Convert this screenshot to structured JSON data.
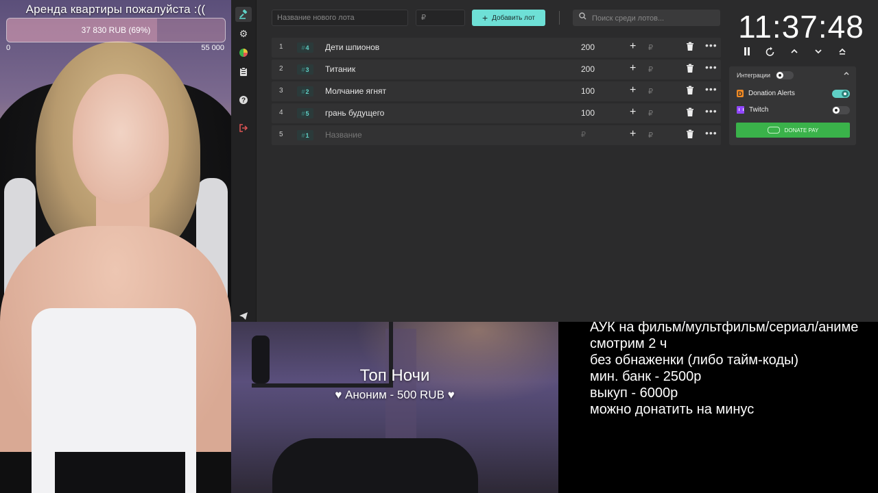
{
  "donation_goal": {
    "title": "Аренда квартиры пожалуйста :((",
    "progress_label": "37 830 RUB (69%)",
    "progress_fraction": 0.69,
    "min_label": "0",
    "max_label": "55 000"
  },
  "sidebar": {
    "items": [
      {
        "icon": "gavel-icon",
        "glyph": "⚒"
      },
      {
        "icon": "gear-icon",
        "glyph": "⚙"
      },
      {
        "icon": "pie-chart-icon",
        "glyph": "◕"
      },
      {
        "icon": "clipboard-icon",
        "glyph": "📋"
      },
      {
        "icon": "help-icon",
        "glyph": "?"
      },
      {
        "icon": "logout-icon",
        "glyph": "⇥"
      }
    ],
    "bottom_icon": "telegram-icon"
  },
  "toolbar": {
    "lot_name_placeholder": "Название нового лота",
    "lot_price_placeholder": "₽",
    "add_lot_label": "Добавить лот",
    "search_placeholder": "Поиск среди лотов..."
  },
  "lots": [
    {
      "index": "1",
      "tag": "4",
      "title": "Дети шпионов",
      "amount": "200",
      "placeholder": false
    },
    {
      "index": "2",
      "tag": "3",
      "title": "Титаник",
      "amount": "200",
      "placeholder": false
    },
    {
      "index": "3",
      "tag": "2",
      "title": "Молчание ягнят",
      "amount": "100",
      "placeholder": false
    },
    {
      "index": "4",
      "tag": "5",
      "title": "грань будущего",
      "amount": "100",
      "placeholder": false
    },
    {
      "index": "5",
      "tag": "1",
      "title": "Название",
      "amount": "₽",
      "placeholder": true
    }
  ],
  "row_ruble": "₽",
  "timer": {
    "display": "11:37:48"
  },
  "integrations": {
    "title": "Интеграции",
    "master_enabled": false,
    "donation_alerts_label": "Donation Alerts",
    "donation_alerts_enabled": true,
    "twitch_label": "Twitch",
    "twitch_enabled": false,
    "donatepay_label": "DONATE PAY"
  },
  "overlay": {
    "top_night_title": "Топ Ночи",
    "top_night_entry": "♥ Аноним - 500 RUB ♥"
  },
  "rules": [
    "АУК на фильм/мультфильм/сериал/аниме",
    "смотрим 2 ч",
    "без обнаженки (либо тайм-коды)",
    "мин. банк - 2500р",
    "выкуп - 6000р",
    "можно донатить на минус"
  ],
  "colors": {
    "accent": "#6ee0d6",
    "donatepay_green": "#3ab24a",
    "app_bg": "#2b2b2c",
    "exit_red": "#e05555"
  }
}
